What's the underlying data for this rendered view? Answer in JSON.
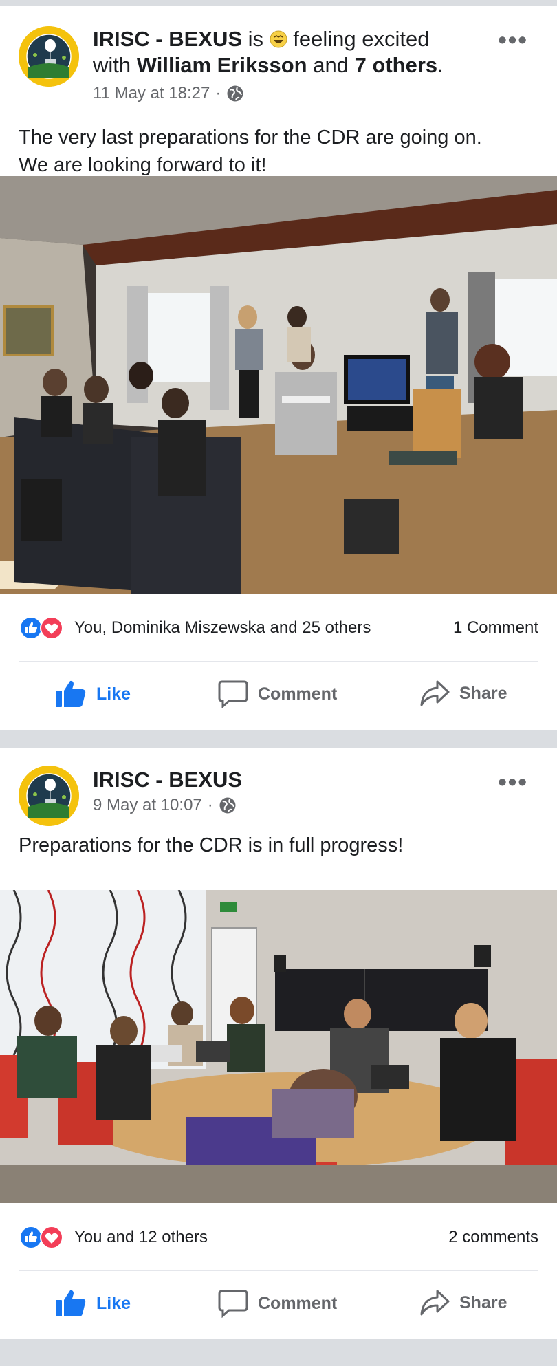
{
  "posts": [
    {
      "page_name": "IRISC - BEXUS",
      "verb": "is",
      "feeling": "feeling excited",
      "with_text": "with",
      "with_person": "William Eriksson",
      "and_text": "and",
      "others": "7 others",
      "period": ".",
      "timestamp": "11 May at 18:27",
      "meta_sep": "·",
      "body_line1": "The very last preparations for the CDR are going on.",
      "body_line2": "We are looking forward to it!",
      "reactions_text": "You, Dominika Miszewska and 25 others",
      "comments_text": "1 Comment",
      "like_label": "Like",
      "comment_label": "Comment",
      "share_label": "Share"
    },
    {
      "page_name": "IRISC - BEXUS",
      "timestamp": "9 May at 10:07",
      "meta_sep": "·",
      "body_line1": "Preparations for the CDR is in full progress!",
      "reactions_text": "You and 12 others",
      "comments_text": "2 comments",
      "like_label": "Like",
      "comment_label": "Comment",
      "share_label": "Share"
    }
  ],
  "colors": {
    "like_blue": "#1877f2",
    "love_red": "#f33e58",
    "muted_text": "#65676b",
    "separator": "#dadde1"
  },
  "icons": [
    "more-options-icon",
    "globe-icon",
    "like-reaction-icon",
    "love-reaction-icon",
    "like-icon",
    "comment-icon",
    "share-icon",
    "feeling-emoji-icon"
  ]
}
